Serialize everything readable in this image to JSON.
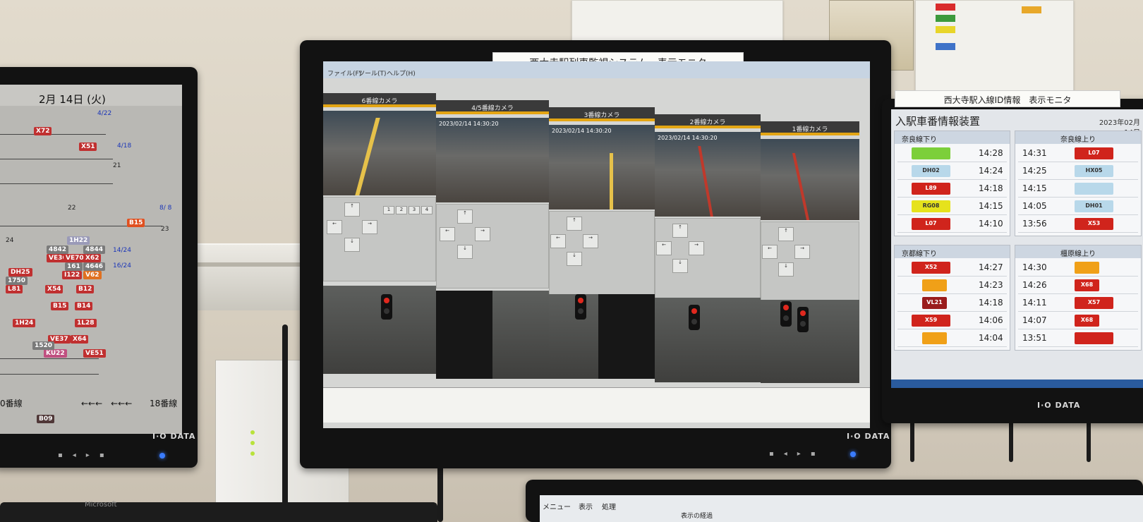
{
  "center_monitor": {
    "label": "西大寺駅列車監視システム　表示モニタ",
    "brand": "I·O DATA",
    "menu": [
      "ファイル(F)",
      "ツール(T)",
      "ヘルプ(H)"
    ],
    "camera_labels": [
      "6番線カメラ",
      "4/5番線カメラ",
      "3番線カメラ",
      "2番線カメラ",
      "1番線カメラ"
    ],
    "timestamps": [
      "2023/02/14 14:30:20",
      "2023/02/14 14:30:20",
      "2023/02/14 14:30:20"
    ]
  },
  "left_monitor": {
    "date": "2月 14日 (火)",
    "brand": "I·O DATA",
    "tags": [
      "X72",
      "X51",
      "B15",
      "1H22",
      "4842",
      "4844",
      "VE36",
      "VE70",
      "X62",
      "161",
      "4646",
      "DH25",
      "I122",
      "V62",
      "1750",
      "L81",
      "X54",
      "B12",
      "B15",
      "B14",
      "1H24",
      "1L28",
      "VE37",
      "X64",
      "KU22",
      "1520",
      "VE51",
      "B09"
    ],
    "bottom_left": "0番線",
    "bottom_right": "18番線",
    "arrows": "←←←　←←←"
  },
  "right_monitor": {
    "label": "西大寺駅入線ID情報　表示モニタ",
    "title": "入駅車番情報装置",
    "date": "2023年02月",
    "day": "14日",
    "brand": "I·O DATA",
    "panels": [
      {
        "title": "奈良線下り",
        "rows": [
          {
            "time": "14:28",
            "tag": "",
            "color": "#7ccf3a"
          },
          {
            "time": "14:24",
            "tag": "DH02",
            "color": "#b8d8ea"
          },
          {
            "time": "14:18",
            "tag": "L89",
            "color": "#d0241c"
          },
          {
            "time": "14:15",
            "tag": "RG08",
            "color": "#e6e21c"
          },
          {
            "time": "14:10",
            "tag": "L07",
            "color": "#d0241c"
          }
        ]
      },
      {
        "title": "奈良線上り",
        "rows": [
          {
            "time": "14:31",
            "tag": "L07",
            "color": "#d0241c"
          },
          {
            "time": "14:25",
            "tag": "HX05",
            "color": "#b8d8ea"
          },
          {
            "time": "14:15",
            "tag": "",
            "color": "#b8d8ea"
          },
          {
            "time": "14:05",
            "tag": "DH01",
            "color": "#b8d8ea"
          },
          {
            "time": "13:56",
            "tag": "X53",
            "color": "#d0241c"
          }
        ]
      },
      {
        "title": "京都線下り",
        "rows": [
          {
            "time": "14:27",
            "tag": "X52",
            "color": "#d0241c"
          },
          {
            "time": "14:23",
            "tag": "",
            "color": "#f0a018"
          },
          {
            "time": "14:18",
            "tag": "VL21",
            "color": "#9a1c1c"
          },
          {
            "time": "14:06",
            "tag": "X59",
            "color": "#d0241c"
          },
          {
            "time": "14:04",
            "tag": "",
            "color": "#f0a018"
          }
        ]
      },
      {
        "title": "橿原線上り",
        "rows": [
          {
            "time": "14:30",
            "tag": "",
            "color": "#f0a018"
          },
          {
            "time": "14:26",
            "tag": "X68",
            "color": "#d0241c"
          },
          {
            "time": "14:11",
            "tag": "X57",
            "color": "#d0241c"
          },
          {
            "time": "14:07",
            "tag": "X68",
            "color": "#d0241c"
          },
          {
            "time": "13:51",
            "tag": "",
            "color": "#d0241c"
          }
        ]
      }
    ]
  },
  "bottom_monitor": {
    "menu": [
      "メニュー",
      "表示",
      "処理"
    ],
    "label": "表示の経過"
  },
  "keyboard": {
    "brand": "Microsoft"
  }
}
